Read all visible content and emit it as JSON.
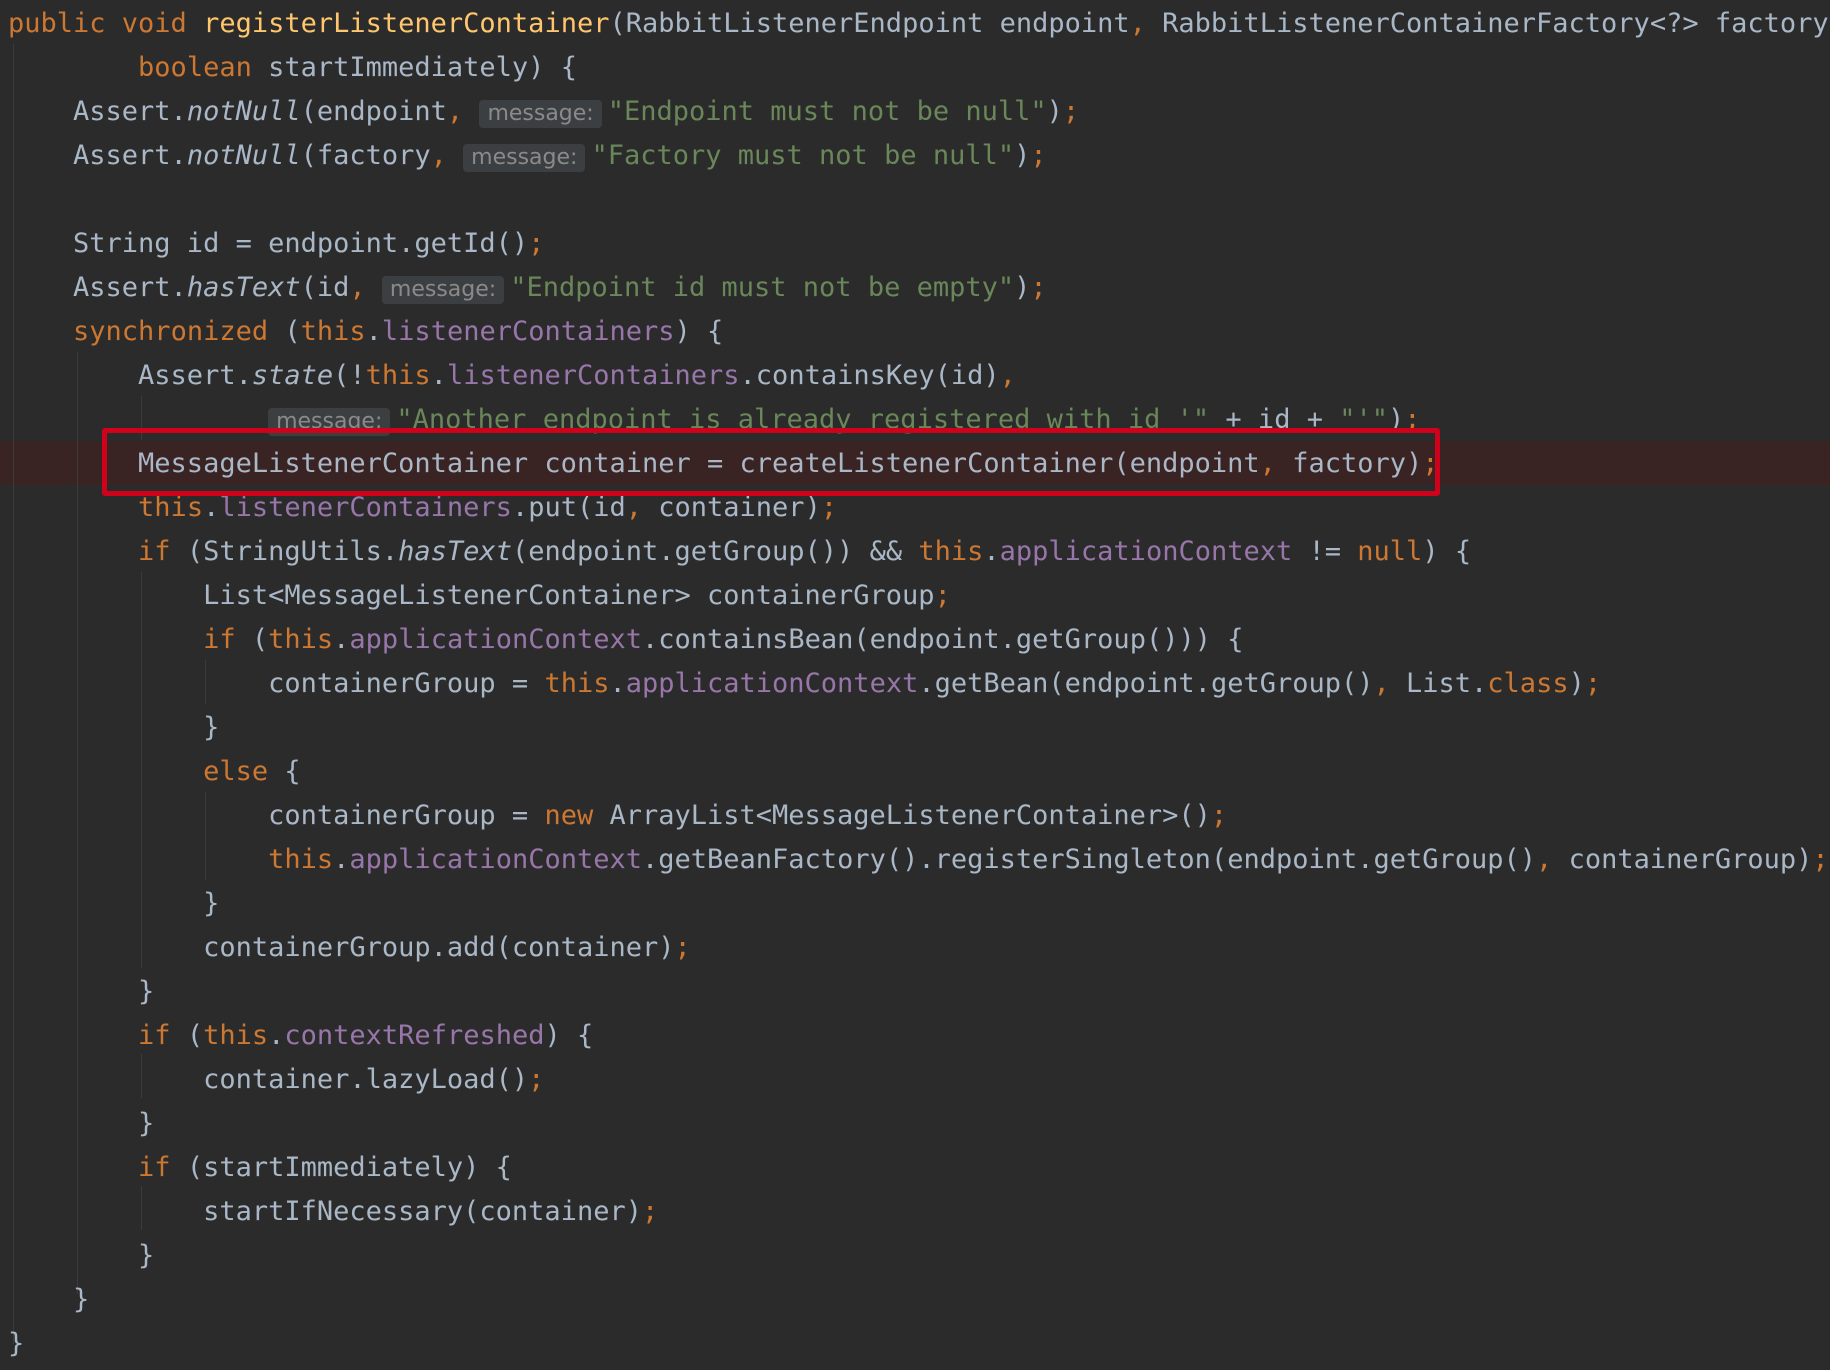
{
  "editor": {
    "hint_label": "message:",
    "highlighted_line": 10,
    "accent_colors": {
      "keyword": "#cc7832",
      "method_declaration": "#ffc66d",
      "string": "#6a8759",
      "field": "#9876aa",
      "default_text": "#a9b7c6",
      "highlight_box": "#d0021b"
    },
    "lines": [
      [
        [
          "kw",
          "public void "
        ],
        [
          "fn",
          "registerListenerContainer"
        ],
        [
          "t",
          "(RabbitListenerEndpoint endpoint"
        ],
        [
          "kw",
          ", "
        ],
        [
          "t",
          "RabbitListenerContainerFactory<?> factory"
        ],
        [
          "kw",
          ","
        ]
      ],
      [
        [
          "t",
          "        "
        ],
        [
          "kw",
          "boolean "
        ],
        [
          "t",
          "startImmediately) {"
        ]
      ],
      [
        [
          "t",
          "    Assert."
        ],
        [
          "it",
          "notNull"
        ],
        [
          "t",
          "(endpoint"
        ],
        [
          "kw",
          ", "
        ],
        [
          "h",
          "message:"
        ],
        [
          "str",
          "\"Endpoint must not be null\""
        ],
        [
          "t",
          ")"
        ],
        [
          "kw",
          ";"
        ]
      ],
      [
        [
          "t",
          "    Assert."
        ],
        [
          "it",
          "notNull"
        ],
        [
          "t",
          "(factory"
        ],
        [
          "kw",
          ", "
        ],
        [
          "h",
          "message:"
        ],
        [
          "str",
          "\"Factory must not be null\""
        ],
        [
          "t",
          ")"
        ],
        [
          "kw",
          ";"
        ]
      ],
      [],
      [
        [
          "t",
          "    String id = endpoint.getId()"
        ],
        [
          "kw",
          ";"
        ]
      ],
      [
        [
          "t",
          "    Assert."
        ],
        [
          "it",
          "hasText"
        ],
        [
          "t",
          "(id"
        ],
        [
          "kw",
          ", "
        ],
        [
          "h",
          "message:"
        ],
        [
          "str",
          "\"Endpoint id must not be empty\""
        ],
        [
          "t",
          ")"
        ],
        [
          "kw",
          ";"
        ]
      ],
      [
        [
          "t",
          "    "
        ],
        [
          "kw",
          "synchronized "
        ],
        [
          "t",
          "("
        ],
        [
          "kw",
          "this"
        ],
        [
          "t",
          "."
        ],
        [
          "fld",
          "listenerContainers"
        ],
        [
          "t",
          ") {"
        ]
      ],
      [
        [
          "t",
          "        Assert."
        ],
        [
          "it",
          "state"
        ],
        [
          "t",
          "(!"
        ],
        [
          "kw",
          "this"
        ],
        [
          "t",
          "."
        ],
        [
          "fld",
          "listenerContainers"
        ],
        [
          "t",
          ".containsKey(id)"
        ],
        [
          "kw",
          ","
        ]
      ],
      [
        [
          "t",
          "                "
        ],
        [
          "h",
          "message:"
        ],
        [
          "str",
          "\"Another endpoint is already registered with id '\" "
        ],
        [
          "t",
          "+ id + "
        ],
        [
          "str",
          "\"'\""
        ],
        [
          "t",
          ")"
        ],
        [
          "kw",
          ";"
        ]
      ],
      [
        [
          "t",
          "        MessageListenerContainer container = createListenerContainer(endpoint"
        ],
        [
          "kw",
          ", "
        ],
        [
          "t",
          "factory)"
        ],
        [
          "kw",
          ";"
        ]
      ],
      [
        [
          "t",
          "        "
        ],
        [
          "kw",
          "this"
        ],
        [
          "t",
          "."
        ],
        [
          "fld",
          "listenerContainers"
        ],
        [
          "t",
          ".put(id"
        ],
        [
          "kw",
          ", "
        ],
        [
          "t",
          "container)"
        ],
        [
          "kw",
          ";"
        ]
      ],
      [
        [
          "t",
          "        "
        ],
        [
          "kw",
          "if "
        ],
        [
          "t",
          "(StringUtils."
        ],
        [
          "it",
          "hasText"
        ],
        [
          "t",
          "(endpoint.getGroup()) && "
        ],
        [
          "kw",
          "this"
        ],
        [
          "t",
          "."
        ],
        [
          "fld",
          "applicationContext "
        ],
        [
          "t",
          "!= "
        ],
        [
          "kw",
          "null"
        ],
        [
          "t",
          ") {"
        ]
      ],
      [
        [
          "t",
          "            List<MessageListenerContainer> containerGroup"
        ],
        [
          "kw",
          ";"
        ]
      ],
      [
        [
          "t",
          "            "
        ],
        [
          "kw",
          "if "
        ],
        [
          "t",
          "("
        ],
        [
          "kw",
          "this"
        ],
        [
          "t",
          "."
        ],
        [
          "fld",
          "applicationContext"
        ],
        [
          "t",
          ".containsBean(endpoint.getGroup())) {"
        ]
      ],
      [
        [
          "t",
          "                containerGroup = "
        ],
        [
          "kw",
          "this"
        ],
        [
          "t",
          "."
        ],
        [
          "fld",
          "applicationContext"
        ],
        [
          "t",
          ".getBean(endpoint.getGroup()"
        ],
        [
          "kw",
          ", "
        ],
        [
          "t",
          "List."
        ],
        [
          "kw",
          "class"
        ],
        [
          "t",
          ")"
        ],
        [
          "kw",
          ";"
        ]
      ],
      [
        [
          "t",
          "            }"
        ]
      ],
      [
        [
          "t",
          "            "
        ],
        [
          "kw",
          "else "
        ],
        [
          "t",
          "{"
        ]
      ],
      [
        [
          "t",
          "                containerGroup = "
        ],
        [
          "kw",
          "new "
        ],
        [
          "t",
          "ArrayList<MessageListenerContainer>()"
        ],
        [
          "kw",
          ";"
        ]
      ],
      [
        [
          "t",
          "                "
        ],
        [
          "kw",
          "this"
        ],
        [
          "t",
          "."
        ],
        [
          "fld",
          "applicationContext"
        ],
        [
          "t",
          ".getBeanFactory().registerSingleton(endpoint.getGroup()"
        ],
        [
          "kw",
          ", "
        ],
        [
          "t",
          "containerGroup)"
        ],
        [
          "kw",
          ";"
        ]
      ],
      [
        [
          "t",
          "            }"
        ]
      ],
      [
        [
          "t",
          "            containerGroup.add(container)"
        ],
        [
          "kw",
          ";"
        ]
      ],
      [
        [
          "t",
          "        }"
        ]
      ],
      [
        [
          "t",
          "        "
        ],
        [
          "kw",
          "if "
        ],
        [
          "t",
          "("
        ],
        [
          "kw",
          "this"
        ],
        [
          "t",
          "."
        ],
        [
          "fld",
          "contextRefreshed"
        ],
        [
          "t",
          ") {"
        ]
      ],
      [
        [
          "t",
          "            container.lazyLoad()"
        ],
        [
          "kw",
          ";"
        ]
      ],
      [
        [
          "t",
          "        }"
        ]
      ],
      [
        [
          "t",
          "        "
        ],
        [
          "kw",
          "if "
        ],
        [
          "t",
          "(startImmediately) {"
        ]
      ],
      [
        [
          "t",
          "            startIfNecessary(container)"
        ],
        [
          "kw",
          ";"
        ]
      ],
      [
        [
          "t",
          "        }"
        ]
      ],
      [
        [
          "t",
          "    }"
        ]
      ],
      [
        [
          "t",
          "}"
        ]
      ]
    ]
  }
}
